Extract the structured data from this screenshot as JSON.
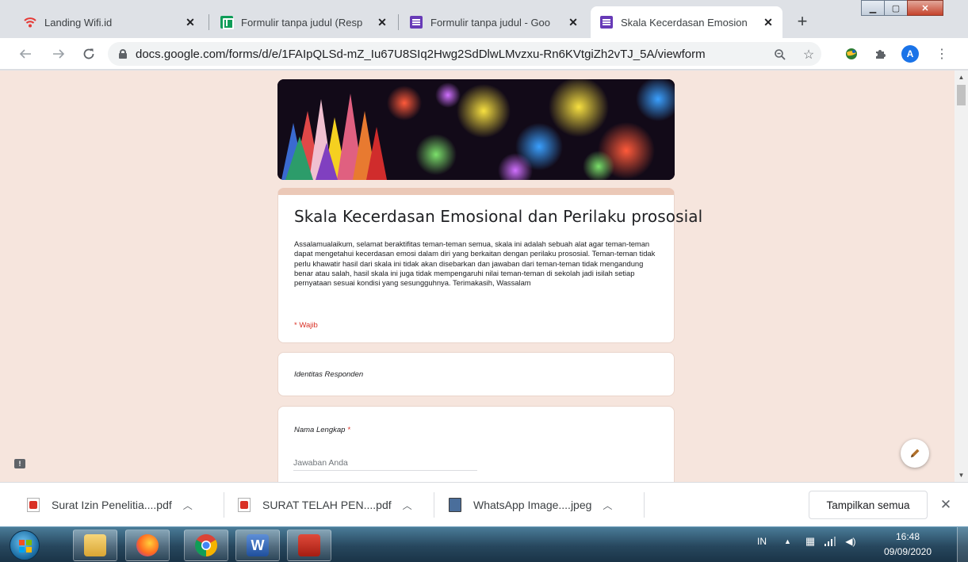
{
  "browser": {
    "tabs": [
      {
        "title": "Landing Wifi.id",
        "icon": "wifi-icon"
      },
      {
        "title": "Formulir tanpa judul (Resp",
        "icon": "sheets-icon"
      },
      {
        "title": "Formulir tanpa judul - Goo",
        "icon": "forms-icon"
      },
      {
        "title": "Skala Kecerdasan Emosion",
        "icon": "forms-icon",
        "active": true
      }
    ],
    "new_tab": "+",
    "url": "docs.google.com/forms/d/e/1FAIpQLSd-mZ_Iu67U8SIq2Hwg2SdDlwLMvzxu-Rn6KVtgiZh2vTJ_5A/viewform",
    "avatar_letter": "A"
  },
  "form": {
    "title": "Skala Kecerdasan Emosional dan Perilaku prososial",
    "description": "Assalamualaikum, selamat beraktifitas teman-teman semua, skala ini adalah sebuah alat agar teman-teman dapat mengetahui kecerdasan emosi dalam diri yang berkaitan dengan perilaku prososial. Teman-teman tidak perlu khawatir hasil dari skala ini tidak akan disebarkan dan jawaban dari teman-teman tidak mengandung benar atau salah, hasil skala ini juga tidak mempengaruhi nilai teman-teman di sekolah jadi isilah setiap pernyataan sesuai kondisi yang sesungguhnya. Terimakasih, Wassalam",
    "required_note": "* Wajib",
    "section_title": "Identitas Responden",
    "question": {
      "label": "Nama Lengkap",
      "required_mark": "*",
      "placeholder": "Jawaban Anda"
    }
  },
  "downloads": {
    "items": [
      {
        "name": "Surat Izin Penelitia....pdf",
        "type": "pdf"
      },
      {
        "name": "SURAT TELAH PEN....pdf",
        "type": "pdf"
      },
      {
        "name": "WhatsApp Image....jpeg",
        "type": "image"
      }
    ],
    "show_all": "Tampilkan semua"
  },
  "taskbar": {
    "apps": [
      "explorer",
      "firefox",
      "chrome",
      "word",
      "acrobat"
    ],
    "language": "IN",
    "time": "16:48",
    "date": "09/09/2020"
  },
  "colors": {
    "page_bg": "#f6e5dd",
    "accent_bar": "#ebc8b7",
    "required": "#d93025",
    "forms_purple": "#673ab7",
    "sheets_green": "#0f9d58"
  }
}
